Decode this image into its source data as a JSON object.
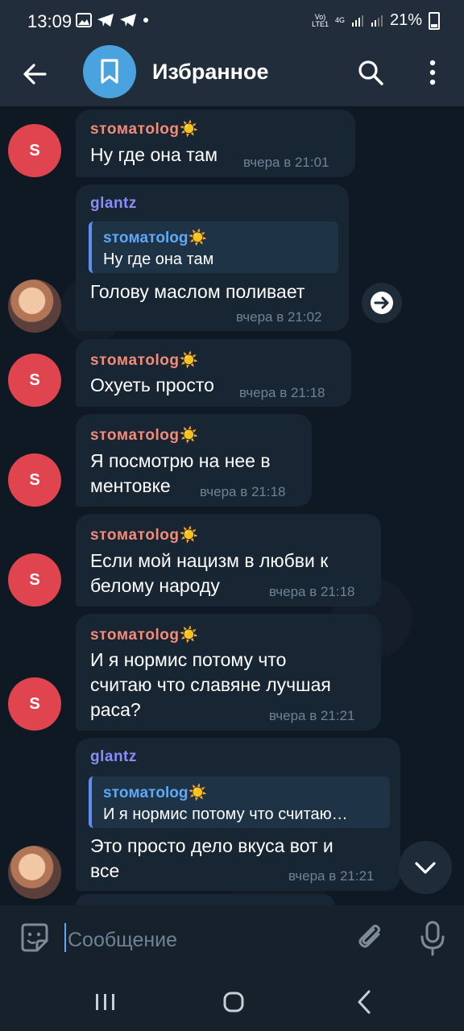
{
  "status_bar": {
    "time": "13:09",
    "network_top": "Vo)",
    "network_bottom": "LTE1",
    "gen": "4G",
    "battery": "21%"
  },
  "header": {
    "title": "Избранное"
  },
  "messages": [
    {
      "sender": "sтoмaтolog☀️",
      "text": "Ну где она там",
      "time": "вчера в 21:01"
    },
    {
      "sender": "glantz",
      "reply_sender": "sтoмaтolog☀️",
      "reply_text": "Ну где она там",
      "text": "Голову маслом поливает",
      "time": "вчера в 21:02"
    },
    {
      "sender": "sтoмaтolog☀️",
      "text": "Охуеть просто",
      "time": "вчера в 21:18"
    },
    {
      "sender": "sтoмaтolog☀️",
      "text": "Я посмотрю на нее в\nментовке",
      "time": "вчера в 21:18"
    },
    {
      "sender": "sтoмaтolog☀️",
      "text": "Если мой нацизм в любви к\nбелому народу",
      "time": "вчера в 21:18"
    },
    {
      "sender": "sтoмaтolog☀️",
      "text": "И я нормис потому что\nсчитаю что славяне лучшая\nраса?",
      "time": "вчера в 21:21"
    },
    {
      "sender": "glantz",
      "reply_sender": "sтoмaтolog☀️",
      "reply_text": "И я нормис потому что считаю…",
      "text": "Это просто дело вкуса вот и\nвсе",
      "time": "вчера в 21:21"
    }
  ],
  "avatar_letter": "S",
  "composer": {
    "placeholder": "Сообщение"
  },
  "colors": {
    "accent": "#5fa8f5",
    "stomatolog_name": "#f28c7a",
    "glantz_name": "#8a8cf7",
    "avatar_red": "#e0444e"
  }
}
